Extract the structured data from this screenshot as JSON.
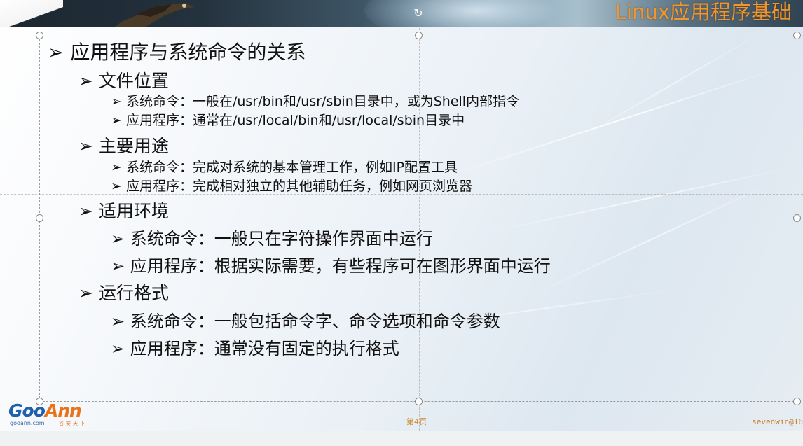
{
  "slide": {
    "title": "Linux应用程序基础",
    "page_number": "第4页",
    "author": "sevenwin@16",
    "logo": {
      "goo": "Goo",
      "ann": "Ann",
      "domain": "gooann.com",
      "tagline": "谷安天下"
    }
  },
  "outline": {
    "heading": "应用程序与系统命令的关系",
    "sections": [
      {
        "label": "文件位置",
        "items": [
          "系统命令：一般在/usr/bin和/usr/sbin目录中，或为Shell内部指令",
          "应用程序：通常在/usr/local/bin和/usr/local/sbin目录中"
        ]
      },
      {
        "label": "主要用途",
        "items": [
          "系统命令：完成对系统的基本管理工作，例如IP配置工具",
          "应用程序：完成相对独立的其他辅助任务，例如网页浏览器"
        ]
      },
      {
        "label": "适用环境",
        "items": [
          "系统命令：一般只在字符操作界面中运行",
          "应用程序：根据实际需要，有些程序可在图形界面中运行"
        ]
      },
      {
        "label": "运行格式",
        "items": [
          "系统命令：一般包括命令字、命令选项和命令参数",
          "应用程序：通常没有固定的执行格式"
        ]
      }
    ]
  },
  "colors": {
    "title": "#f0962c",
    "text": "#111111",
    "logo_blue": "#1f5fae",
    "logo_orange": "#e8731a"
  },
  "icons": {
    "bullet": "arrow-bullet-icon",
    "rotate": "rotate-handle-icon",
    "decoration": "eagle-icon"
  }
}
